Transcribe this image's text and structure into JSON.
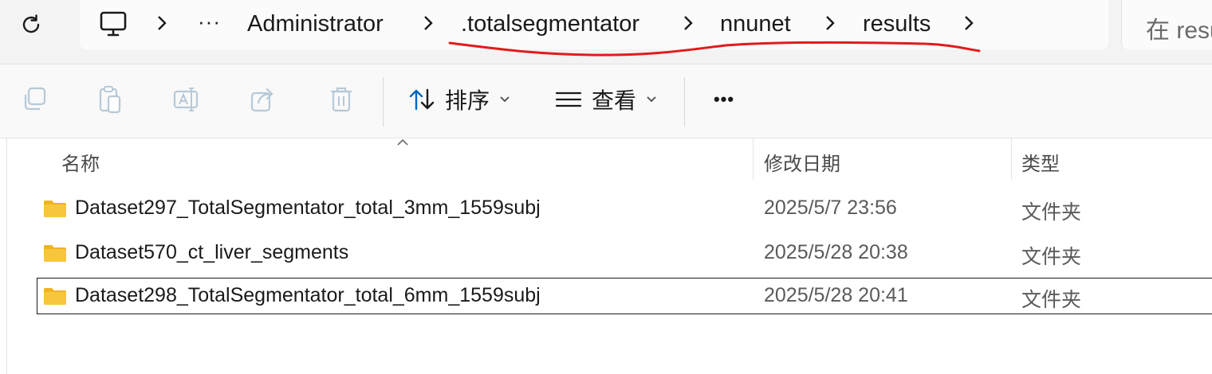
{
  "address_bar": {
    "overflow": "···",
    "breadcrumbs": [
      {
        "label": "Administrator"
      },
      {
        "label": ".totalsegmentator"
      },
      {
        "label": "nnunet"
      },
      {
        "label": "results"
      }
    ],
    "search_placeholder": "在 resu"
  },
  "annotation_color": "#e21b1b",
  "toolbar": {
    "sort_label": "排序",
    "view_label": "查看",
    "more_label": "•••"
  },
  "columns": {
    "name": "名称",
    "modified": "修改日期",
    "type": "类型"
  },
  "files": [
    {
      "name": "Dataset297_TotalSegmentator_total_3mm_1559subj",
      "modified": "2025/5/7 23:56",
      "type": "文件夹",
      "selected": false
    },
    {
      "name": "Dataset570_ct_liver_segments",
      "modified": "2025/5/28 20:38",
      "type": "文件夹",
      "selected": false
    },
    {
      "name": "Dataset298_TotalSegmentator_total_6mm_1559subj",
      "modified": "2025/5/28 20:41",
      "type": "文件夹",
      "selected": true
    }
  ],
  "icons": {
    "refresh": "refresh-icon",
    "this_pc": "computer-icon",
    "copy": "copy-icon",
    "paste": "paste-icon",
    "rename": "rename-icon",
    "share": "share-icon",
    "delete": "trash-icon",
    "sort": "sort-icon",
    "view": "view-list-icon",
    "folder": "folder-icon"
  },
  "colors": {
    "folder_yellow": "#f8c63d",
    "disabled_icon": "#b7c9d8",
    "accent": "#0067c0"
  }
}
